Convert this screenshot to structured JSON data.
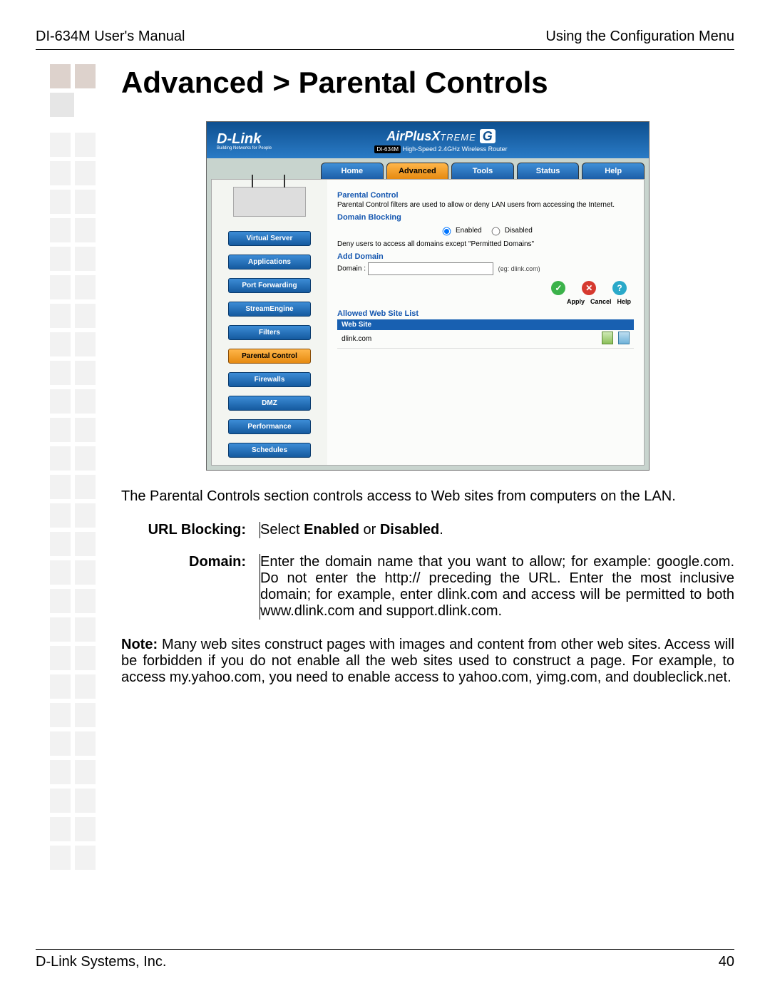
{
  "header": {
    "left": "DI-634M User's Manual",
    "right": "Using the Configuration Menu"
  },
  "title": "Advanced > Parental Controls",
  "router": {
    "brand": "D-Link",
    "brand_sub": "Building Networks for People",
    "product_line": "AirPlus Xtreme G",
    "model_tag": "DI-634M",
    "model_desc": "High-Speed 2.4GHz Wireless Router",
    "tabs": [
      "Home",
      "Advanced",
      "Tools",
      "Status",
      "Help"
    ],
    "active_tab": "Advanced",
    "sidebar": [
      "Virtual Server",
      "Applications",
      "Port Forwarding",
      "StreamEngine",
      "Filters",
      "Parental Control",
      "Firewalls",
      "DMZ",
      "Performance",
      "Schedules"
    ],
    "active_side": "Parental Control",
    "sections": {
      "pc_title": "Parental Control",
      "pc_desc": "Parental Control filters are used to allow or deny LAN users from accessing the Internet.",
      "domain_blocking": "Domain Blocking",
      "enabled": "Enabled",
      "disabled": "Disabled",
      "deny_text": "Deny users to access all domains except \"Permitted Domains\"",
      "add_domain": "Add Domain",
      "domain_label": "Domain :",
      "domain_hint": "(eg: dlink.com)",
      "apply": "Apply",
      "cancel": "Cancel",
      "help": "Help",
      "allowed": "Allowed Web Site List",
      "th": "Web Site",
      "row1": "dlink.com"
    }
  },
  "body1": "The Parental Controls section controls access to Web sites from computers on the LAN.",
  "defs": {
    "url_label": "URL Blocking:",
    "url_text_pre": "Select ",
    "url_text_b1": "Enabled",
    "url_text_mid": " or ",
    "url_text_b2": "Disabled",
    "url_text_post": ".",
    "domain_label": "Domain:",
    "domain_text": "Enter the domain name that you want to allow; for example: google.com. Do not enter the http:// preceding the URL. Enter the most inclusive domain; for example, enter dlink.com and access will be permitted to both www.dlink.com and support.dlink.com."
  },
  "note_label": "Note:",
  "note_text": " Many web sites construct pages with images and content from other web sites. Access will be forbidden if you do not enable all the web sites used to construct a page. For example, to access my.yahoo.com, you need to enable access to yahoo.com, yimg.com, and doubleclick.net.",
  "footer": {
    "left": "D-Link Systems, Inc.",
    "right": "40"
  }
}
